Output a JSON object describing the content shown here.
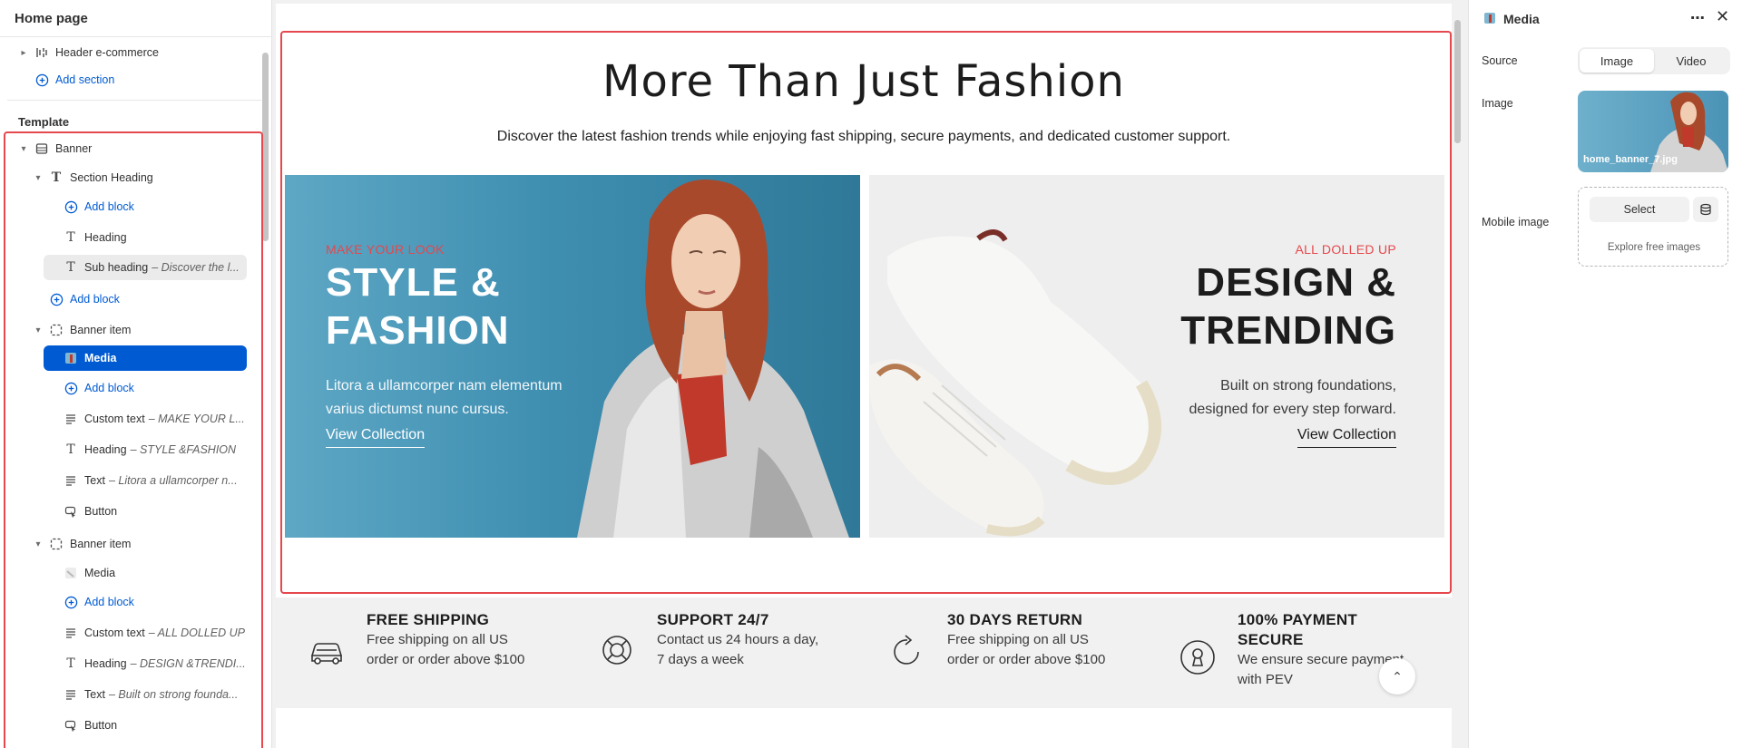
{
  "left_panel": {
    "title": "Home page",
    "header_section": "Header e-commerce",
    "add_section": "Add section",
    "template_label": "Template",
    "tree": {
      "banner": "Banner",
      "section_heading": "Section Heading",
      "add_block_1": "Add block",
      "heading": "Heading",
      "sub_heading": "Sub heading",
      "sub_heading_detail": "– Discover the l...",
      "add_block_2": "Add block",
      "banner_item_1": "Banner item",
      "media_1": "Media",
      "add_block_3": "Add block",
      "custom_text_1": "Custom text",
      "custom_text_1_detail": "– MAKE YOUR L...",
      "heading_1": "Heading",
      "heading_1_detail": "– STYLE &FASHION",
      "text_1": "Text",
      "text_1_detail": "– Litora a ullamcorper n...",
      "button_1": "Button",
      "banner_item_2": "Banner item",
      "media_2": "Media",
      "add_block_4": "Add block",
      "custom_text_2": "Custom text",
      "custom_text_2_detail": "– ALL DOLLED UP",
      "heading_2": "Heading",
      "heading_2_detail": "– DESIGN &TRENDI...",
      "text_2": "Text",
      "text_2_detail": "– Built on strong founda...",
      "button_2": "Button"
    }
  },
  "canvas": {
    "title": "More Than Just Fashion",
    "subtitle": "Discover the latest fashion trends while enjoying fast shipping, secure payments, and dedicated customer support.",
    "banner_left": {
      "eyebrow": "MAKE YOUR LOOK",
      "title_line1": "STYLE &",
      "title_line2": "FASHION",
      "text_line1": "Litora a ullamcorper nam elementum",
      "text_line2": "varius dictumst nunc cursus.",
      "button": "View Collection"
    },
    "banner_right": {
      "eyebrow": "ALL DOLLED UP",
      "title_line1": "DESIGN &",
      "title_line2": "TRENDING",
      "text_line1": "Built on strong foundations,",
      "text_line2": "designed for every step forward.",
      "button": "View Collection"
    },
    "features": [
      {
        "title": "FREE SHIPPING",
        "text_line1": "Free shipping on all US",
        "text_line2": "order or order above $100",
        "icon": "car-icon"
      },
      {
        "title": "SUPPORT 24/7",
        "text_line1": "Contact us 24 hours a day,",
        "text_line2": "7 days a week",
        "icon": "lifebuoy-icon"
      },
      {
        "title": "30 DAYS RETURN",
        "text_line1": "Free shipping on all US",
        "text_line2": "order or order above $100",
        "icon": "return-arrow-icon"
      },
      {
        "title_line1": "100% PAYMENT",
        "title_line2": "SECURE",
        "text_line1": "We ensure secure payment",
        "text_line2": "with PEV",
        "icon": "keyhole-icon"
      }
    ]
  },
  "right_panel": {
    "title": "Media",
    "source_label": "Source",
    "source_options": [
      "Image",
      "Video"
    ],
    "source_selected": "Image",
    "image_label": "Image",
    "image_filename": "home_banner_7.jpg",
    "mobile_image_label": "Mobile image",
    "select_button": "Select",
    "explore_link": "Explore free images"
  },
  "colors": {
    "accent_blue": "#005bd3",
    "outline_red": "#e5484d",
    "banner_blue": "#3f8fb1"
  }
}
